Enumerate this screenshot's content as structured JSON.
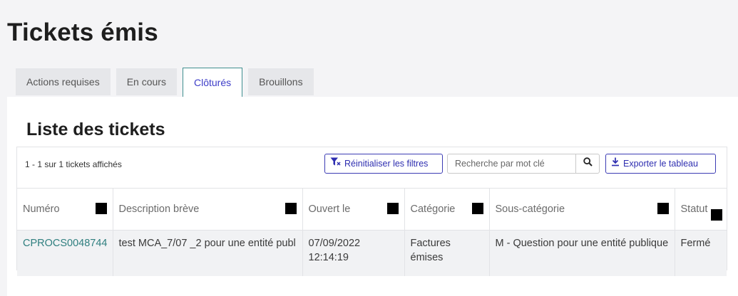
{
  "page": {
    "title": "Tickets émis"
  },
  "tabs": [
    {
      "label": "Actions requises",
      "active": false
    },
    {
      "label": "En cours",
      "active": false
    },
    {
      "label": "Clôturés",
      "active": true
    },
    {
      "label": "Brouillons",
      "active": false
    }
  ],
  "list": {
    "title": "Liste des tickets",
    "count_text": "1 - 1 sur 1 tickets affichés",
    "reset_filters_label": "Réinitialiser les filtres",
    "search_placeholder": "Recherche par mot clé",
    "export_label": "Exporter le tableau"
  },
  "table": {
    "columns": [
      "Numéro",
      "Description brève",
      "Ouvert le",
      "Catégorie",
      "Sous-catégorie",
      "Statut"
    ],
    "rows": [
      {
        "numero": "CPROCS0048744",
        "description": "test MCA_7/07 _2 pour une entité publ",
        "ouvert_le": "07/09/2022 12:14:19",
        "categorie": "Factures émises",
        "sous_categorie": "M - Question pour une entité publique",
        "statut": "Fermé"
      }
    ]
  },
  "colors": {
    "accent": "#3c3cb4",
    "link": "#2f7f7f",
    "active_tab_border": "#3f8f8f"
  },
  "icons": {
    "reset": "filter-reset-icon",
    "search": "search-icon",
    "export": "download-icon",
    "sort": "sort-square-icon"
  }
}
